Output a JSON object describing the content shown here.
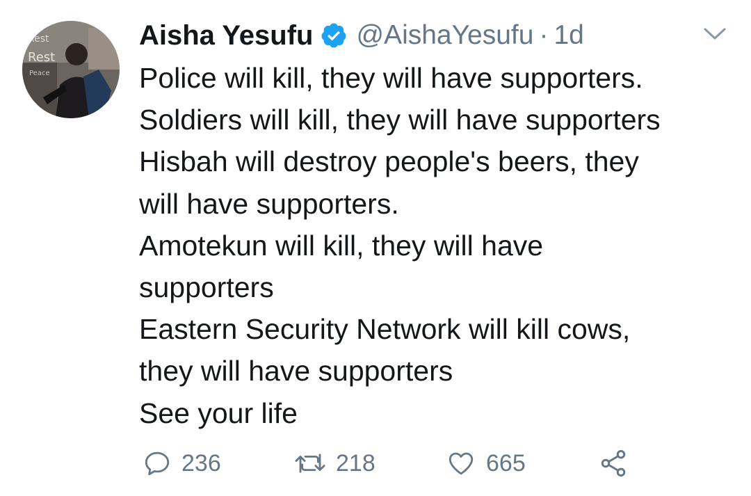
{
  "tweet": {
    "display_name": "Aisha Yesufu",
    "handle": "@AishaYesufu",
    "separator": "·",
    "time": "1d",
    "verified_icon": "verified-badge-icon",
    "lines": [
      "Police will kill, they will have supporters.",
      "Soldiers will kill, they will have supporters",
      "Hisbah will destroy people's beers, they",
      "will have supporters.",
      "Amotekun will kill, they will have",
      "supporters",
      "Eastern Security Network will kill cows,",
      "they will have supporters",
      "See your life"
    ],
    "actions": {
      "reply_count": "236",
      "retweet_count": "218",
      "like_count": "665"
    }
  },
  "colors": {
    "text": "#14171a",
    "secondary": "#657786",
    "verified": "#1da1f2"
  }
}
